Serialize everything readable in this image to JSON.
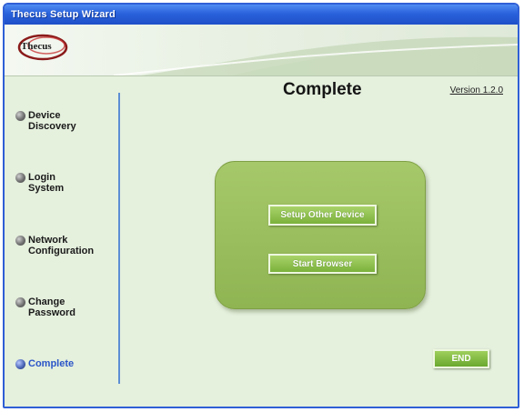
{
  "window": {
    "title": "Thecus Setup Wizard"
  },
  "banner": {
    "logo_text": "Thecus"
  },
  "nav": {
    "items": [
      {
        "label": "Device\nDiscovery",
        "active": false
      },
      {
        "label": "Login\nSystem",
        "active": false
      },
      {
        "label": "Network\nConfiguration",
        "active": false
      },
      {
        "label": "Change\nPassword",
        "active": false
      },
      {
        "label": "Complete",
        "active": true
      }
    ]
  },
  "main": {
    "title": "Complete",
    "version": "Version 1.2.0",
    "setup_other_label": "Setup Other Device",
    "start_browser_label": "Start Browser",
    "end_label": "END"
  },
  "colors": {
    "titlebar": "#2a62dc",
    "panel_green": "#9bbf5e",
    "button_green": "#7bb13b",
    "active_nav": "#2a55c8"
  }
}
